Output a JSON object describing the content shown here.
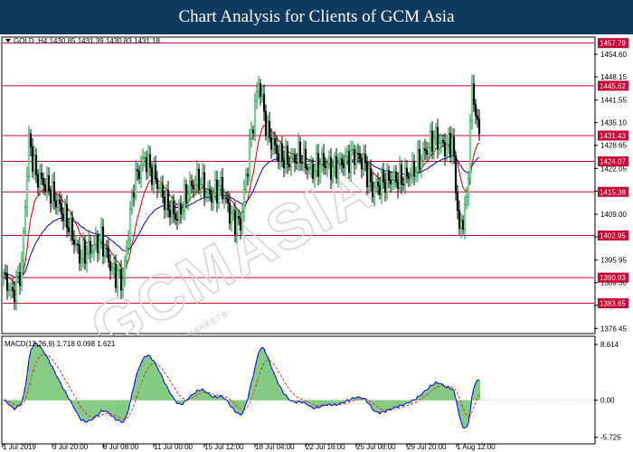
{
  "banner": {
    "title": "Chart Analysis for Clients of GCM Asia"
  },
  "colors": {
    "banner": "#0f3a5e",
    "bull": "#009933",
    "bear": "#000000",
    "ma_fast": "#cc0000",
    "ma_slow": "#0000cc",
    "level_line": "#cc0033",
    "level_label": "#cc0033",
    "macd_hist": "#33aa33",
    "macd_signal": "#dd3333",
    "macd_line": "#0000dd"
  },
  "watermark": {
    "main": "GCMASIA",
    "sub": "GLOBAL CAPITAL MARKETS"
  },
  "chart_data": [
    {
      "type": "candlestick",
      "symbol": "GOLD",
      "timeframe": "H4",
      "ohlc_header": {
        "open": "1430.85",
        "high": "1431.39",
        "low": "1430.83",
        "close": "1431.18"
      },
      "header_text": "GOLD ,H4  1430.85 1431.39 1430.83 1431.18",
      "ylim": [
        1375.0,
        1459.5
      ],
      "y_ticks": [
        "1454.60",
        "1448.15",
        "1441.55",
        "1435.10",
        "1428.65",
        "1422.05",
        "1415.60",
        "1409.00",
        "1402.55",
        "1395.95",
        "1389.50",
        "1383.05",
        "1376.45"
      ],
      "x_labels": [
        "1 Jul 2019",
        "3 Jul 20:00",
        "8 Jul 08:00",
        "11 Jul 00:00",
        "15 Jul 12:00",
        "18 Jul 04:00",
        "22 Jul 16:00",
        "25 Jul 08:00",
        "29 Jul 20:00",
        "1 Aug 12:00"
      ],
      "levels": [
        {
          "label": "1457.79",
          "value": 1457.79
        },
        {
          "label": "1445.62",
          "value": 1445.62
        },
        {
          "label": "1431.43",
          "value": 1431.43
        },
        {
          "label": "1424.07",
          "value": 1424.07
        },
        {
          "label": "1415.38",
          "value": 1415.38
        },
        {
          "label": "1402.95",
          "value": 1402.95
        },
        {
          "label": "1390.93",
          "value": 1390.93
        },
        {
          "label": "1383.65",
          "value": 1383.65
        }
      ],
      "anchor_closes": [
        [
          0,
          1391
        ],
        [
          5,
          1386
        ],
        [
          10,
          1394
        ],
        [
          14,
          1430
        ],
        [
          18,
          1420
        ],
        [
          24,
          1417
        ],
        [
          30,
          1412
        ],
        [
          36,
          1406
        ],
        [
          42,
          1397
        ],
        [
          48,
          1399
        ],
        [
          54,
          1402
        ],
        [
          60,
          1393
        ],
        [
          66,
          1390
        ],
        [
          72,
          1418
        ],
        [
          78,
          1425
        ],
        [
          84,
          1419
        ],
        [
          90,
          1412
        ],
        [
          96,
          1408
        ],
        [
          102,
          1416
        ],
        [
          108,
          1419
        ],
        [
          114,
          1414
        ],
        [
          120,
          1417
        ],
        [
          126,
          1408
        ],
        [
          131,
          1406
        ],
        [
          136,
          1428
        ],
        [
          141,
          1447
        ],
        [
          146,
          1432
        ],
        [
          152,
          1426
        ],
        [
          158,
          1424
        ],
        [
          164,
          1426
        ],
        [
          170,
          1421
        ],
        [
          176,
          1424
        ],
        [
          182,
          1422
        ],
        [
          188,
          1424
        ],
        [
          194,
          1426
        ],
        [
          199,
          1424
        ],
        [
          204,
          1416
        ],
        [
          209,
          1418
        ],
        [
          214,
          1419
        ],
        [
          220,
          1419
        ],
        [
          226,
          1421
        ],
        [
          232,
          1426
        ],
        [
          238,
          1431
        ],
        [
          244,
          1428
        ],
        [
          248,
          1430
        ],
        [
          252,
          1404
        ],
        [
          256,
          1412
        ],
        [
          259,
          1445
        ],
        [
          263,
          1431
        ]
      ]
    },
    {
      "type": "macd",
      "label": "MACD(12,26,9) 1.718 0.098 1.621",
      "params": "12,26,9",
      "values": {
        "macd": "1.718",
        "signal": "0.098",
        "hist": "1.621"
      },
      "ylim": [
        -6.6,
        9.6
      ],
      "y_ticks": [
        "8.614",
        "0.00",
        "-5.725"
      ]
    }
  ]
}
